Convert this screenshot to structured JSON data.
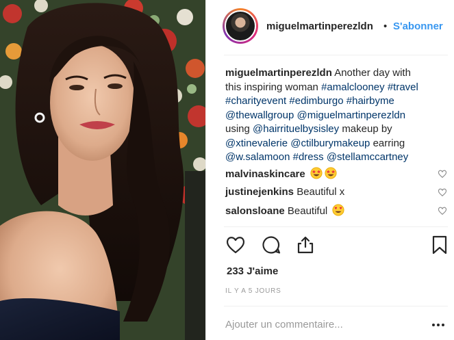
{
  "post": {
    "username": "miguelmartinperezldn",
    "separator": "•",
    "follow_label": "S'abonner",
    "caption": {
      "author": "miguelmartinperezldn",
      "lines": [
        [
          "Another day with"
        ],
        [
          "this inspiring woman "
        ],
        [],
        [],
        [],
        [
          "using "
        ],
        [
          "makeup by"
        ],
        [],
        []
      ],
      "text_1": "Another day with",
      "text_2": "this inspiring woman",
      "tag_amalclooney": "#amalclooney",
      "tag_travel": "#travel",
      "tag_charityevent": "#charityevent",
      "tag_edimburgo": "#edimburgo",
      "tag_hairbyme": "#hairbyme",
      "mention_thewallgroup": "@thewallgroup",
      "mention_miguel": "@miguelmartinperezldn",
      "text_using": "using",
      "mention_hairrituel": "@hairrituelbysisley",
      "text_makeup": "makeup by",
      "mention_xtine": "@xtinevalerie",
      "mention_ctilbury": "@ctilburymakeup",
      "text_earring": "earring",
      "mention_salamoon": "@w.salamoon",
      "tag_dress": "#dress",
      "mention_stella": "@stellamccartney"
    },
    "comments": [
      {
        "user": "malvinaskincare",
        "text": "",
        "emoji": [
          "star-struck",
          "star-struck"
        ]
      },
      {
        "user": "justinejenkins",
        "text": "Beautiful x",
        "emoji": []
      },
      {
        "user": "salonsloane",
        "text": "Beautiful",
        "emoji": [
          "heart-eyes"
        ]
      }
    ],
    "likes": "233 J'aime",
    "timestamp": "IL Y A 5 JOURS",
    "comment_placeholder": "Ajouter un commentaire...",
    "colors": {
      "link": "#003569",
      "follow": "#3897f0",
      "muted": "#999999",
      "text": "#262626"
    },
    "icons": {
      "like": "heart-outline-icon",
      "comment": "speech-bubble-icon",
      "share": "share-upload-icon",
      "save": "bookmark-icon",
      "more": "ellipsis-icon"
    }
  }
}
